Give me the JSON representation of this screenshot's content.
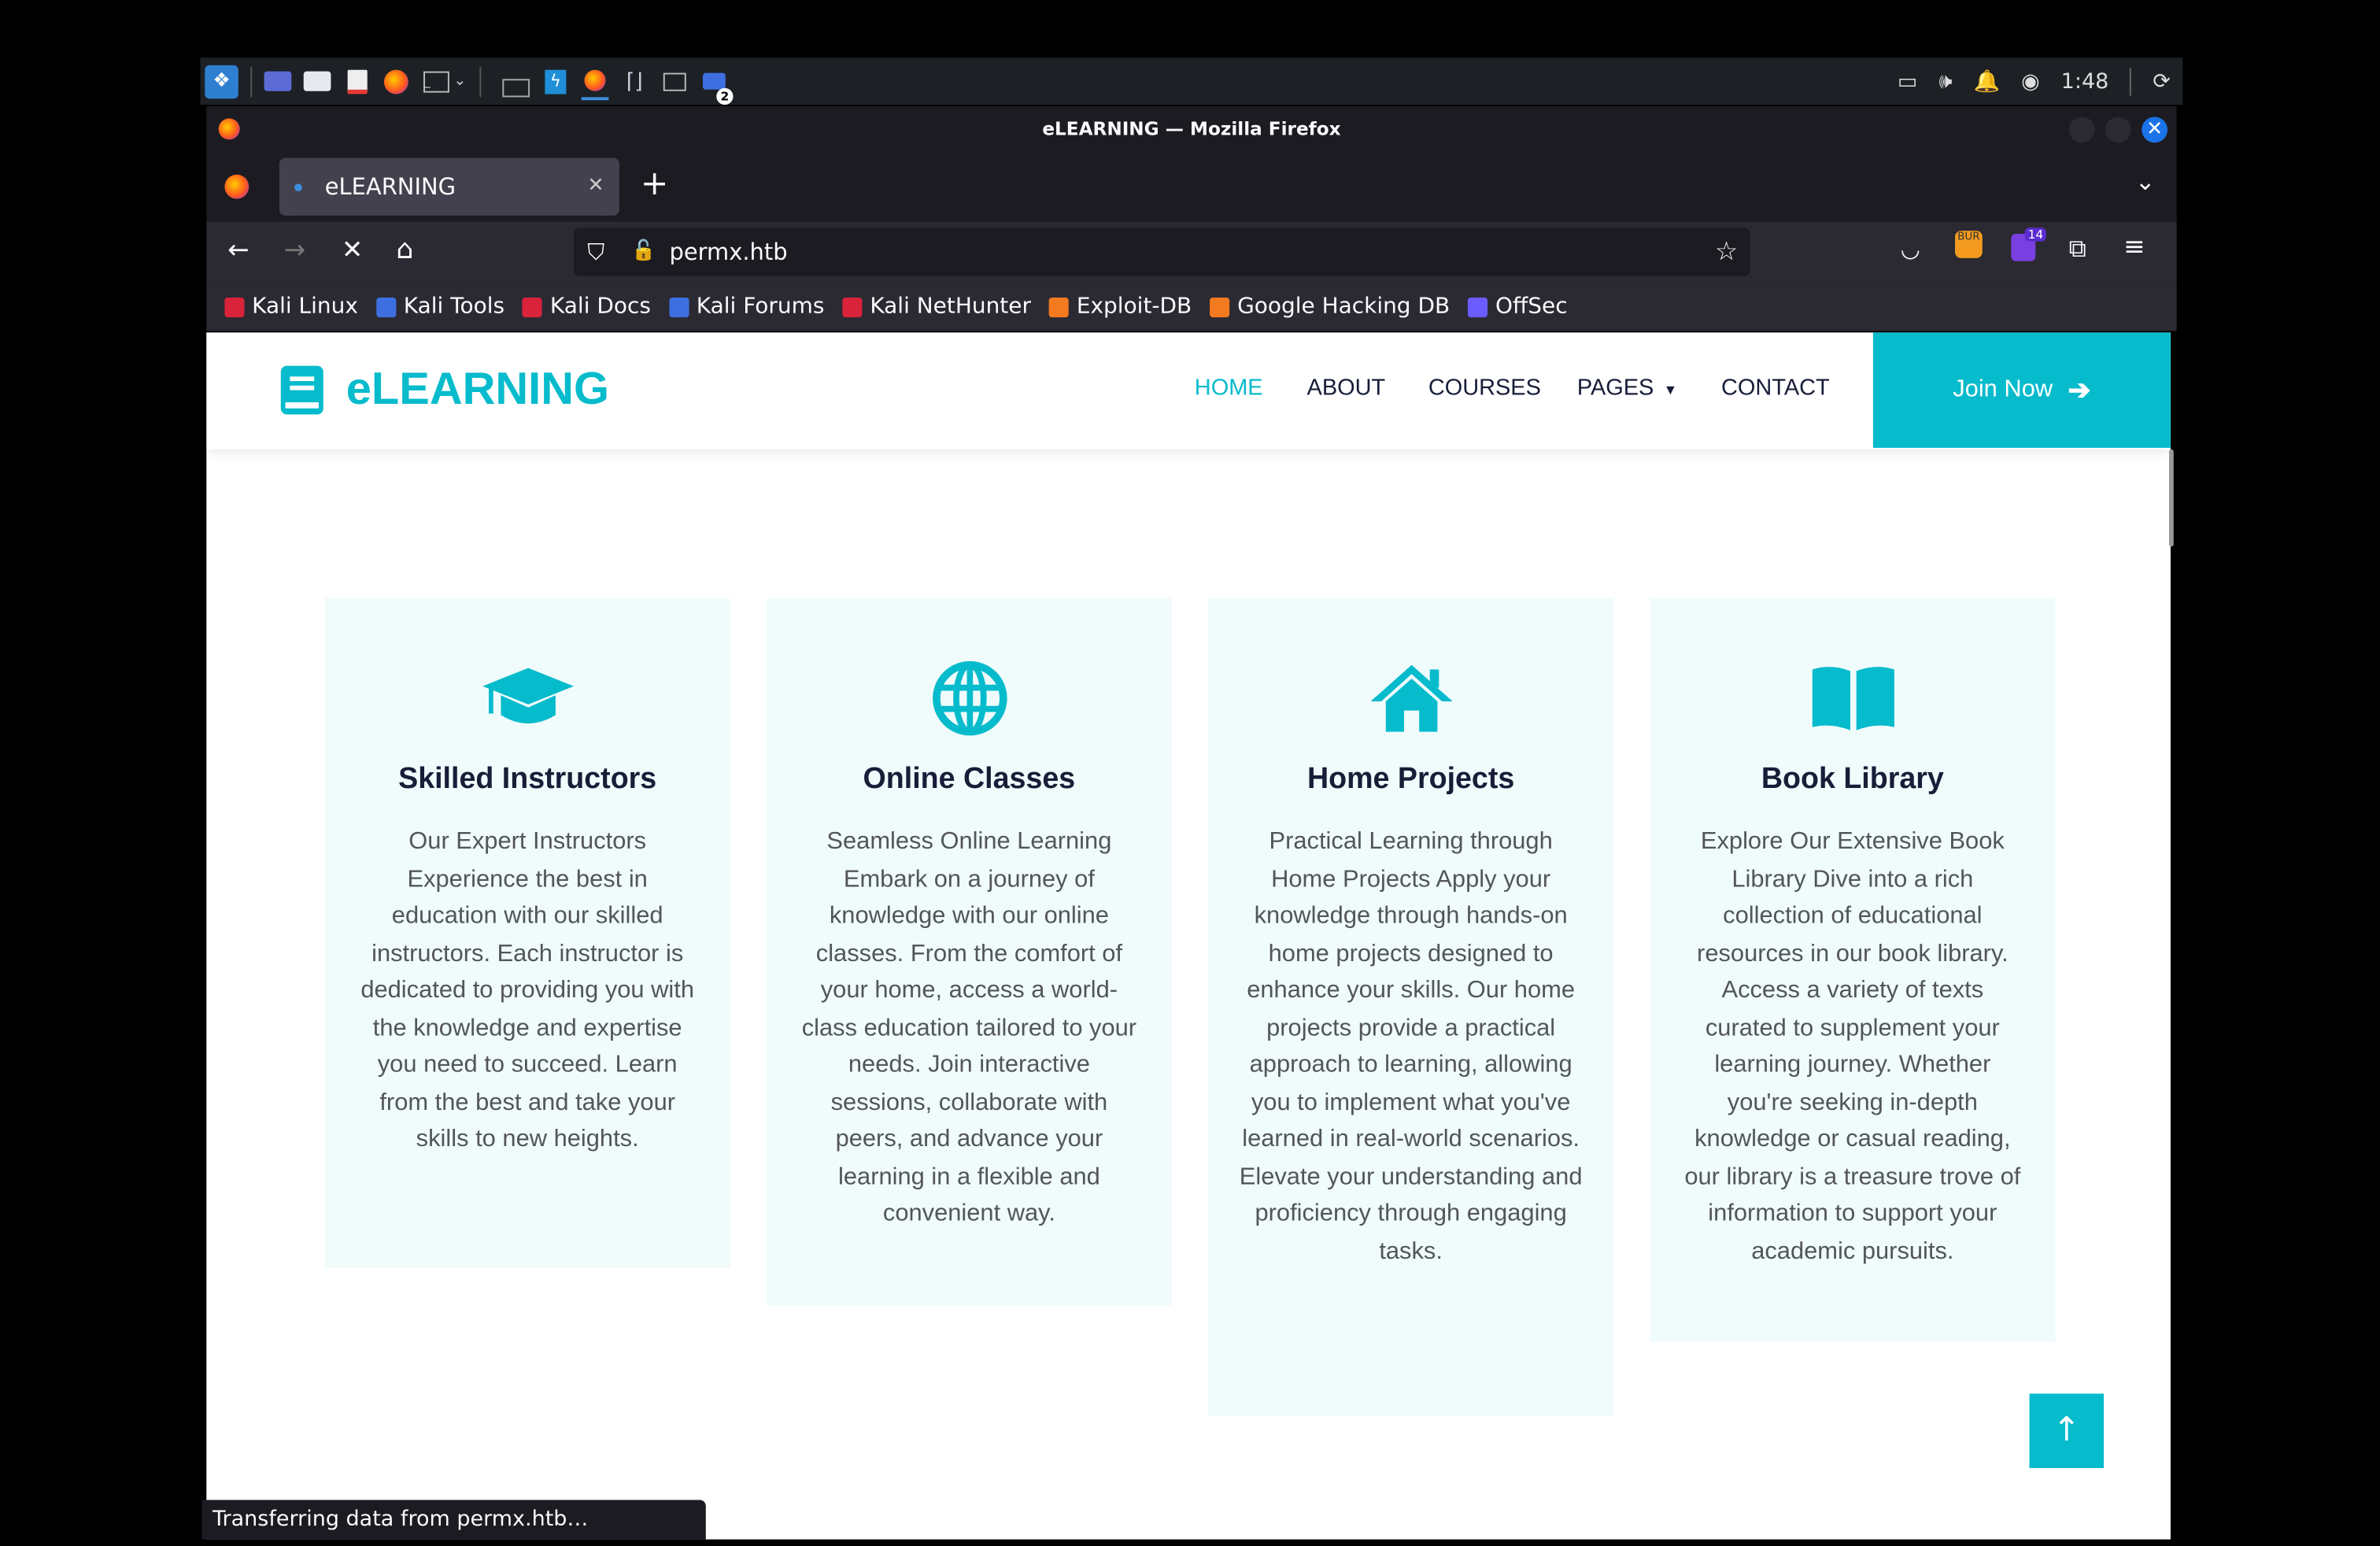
{
  "taskbar": {
    "clock": "1:48",
    "badge_count": "2"
  },
  "window": {
    "title": "eLEARNING — Mozilla Firefox"
  },
  "browser": {
    "tab_title": "eLEARNING",
    "url": "permx.htb",
    "extension_badge": "14",
    "extension_label": "BUR",
    "status": "Transferring data from permx.htb…",
    "bookmarks": [
      {
        "label": "Kali Linux",
        "color": "#d8233b"
      },
      {
        "label": "Kali Tools",
        "color": "#3d6fe0"
      },
      {
        "label": "Kali Docs",
        "color": "#d8233b"
      },
      {
        "label": "Kali Forums",
        "color": "#3d6fe0"
      },
      {
        "label": "Kali NetHunter",
        "color": "#d8233b"
      },
      {
        "label": "Exploit-DB",
        "color": "#f47a1f"
      },
      {
        "label": "Google Hacking DB",
        "color": "#f47a1f"
      },
      {
        "label": "OffSec",
        "color": "#6a5cff"
      }
    ]
  },
  "site": {
    "brand": "eLEARNING",
    "accent": "#06bbcc",
    "nav": {
      "home": "HOME",
      "about": "ABOUT",
      "courses": "COURSES",
      "pages": "PAGES",
      "contact": "CONTACT"
    },
    "join": "Join Now"
  },
  "cards": [
    {
      "title": "Skilled Instructors",
      "icon": "graduation-cap-icon",
      "text": "Our Expert Instructors Experience the best in education with our skilled instructors. Each instructor is dedicated to providing you with the knowledge and expertise you need to succeed. Learn from the best and take your skills to new heights."
    },
    {
      "title": "Online Classes",
      "icon": "globe-icon",
      "text": "Seamless Online Learning Embark on a journey of knowledge with our online classes. From the comfort of your home, access a world-class education tailored to your needs. Join interactive sessions, collaborate with peers, and advance your learning in a flexible and convenient way."
    },
    {
      "title": "Home Projects",
      "icon": "home-icon",
      "text": "Practical Learning through Home Projects Apply your knowledge through hands-on home projects designed to enhance your skills. Our home projects provide a practical approach to learning, allowing you to implement what you've learned in real-world scenarios. Elevate your understanding and proficiency through engaging tasks."
    },
    {
      "title": "Book Library",
      "icon": "book-open-icon",
      "text": "Explore Our Extensive Book Library Dive into a rich collection of educational resources in our book library. Access a variety of texts curated to supplement your learning journey. Whether you're seeking in-depth knowledge or casual reading, our library is a treasure trove of information to support your academic pursuits."
    }
  ]
}
